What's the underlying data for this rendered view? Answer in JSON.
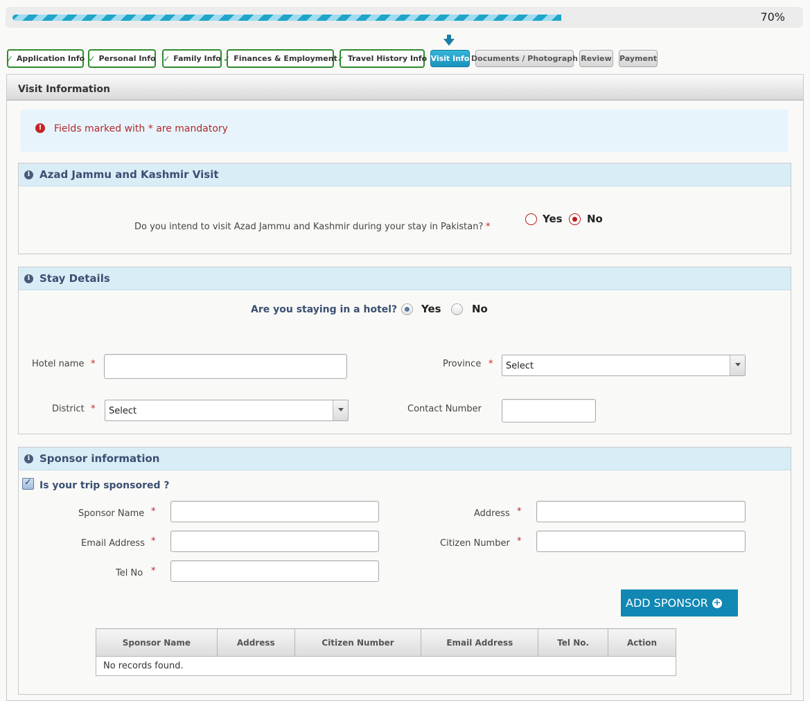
{
  "progress": {
    "percent_label": "70%",
    "fraction": 0.7
  },
  "steps": [
    {
      "label": "Application Info",
      "state": "done"
    },
    {
      "label": "Personal Info",
      "state": "done"
    },
    {
      "label": "Family Info",
      "state": "done"
    },
    {
      "label": "Finances & Employment",
      "state": "done"
    },
    {
      "label": "Travel History Info",
      "state": "done"
    },
    {
      "label": "Visit Info",
      "state": "active"
    },
    {
      "label": "Documents / Photograph",
      "state": "todo"
    },
    {
      "label": "Review",
      "state": "todo"
    },
    {
      "label": "Payment",
      "state": "todo"
    }
  ],
  "check_mark": "✓",
  "panel": {
    "title": "Visit Information"
  },
  "mandatory_note": {
    "text_before": "Fields marked with ",
    "asterisk": "*",
    "text_after": " are mandatory"
  },
  "asterisk": "*",
  "ajk": {
    "title": "Azad Jammu and Kashmir Visit",
    "question": "Do you intend to visit Azad Jammu and Kashmir during your stay in Pakistan?",
    "yes": "Yes",
    "no": "No",
    "selected": "No"
  },
  "stay": {
    "title": "Stay Details",
    "question": "Are you staying in a hotel?",
    "yes": "Yes",
    "no": "No",
    "selected": "Yes",
    "hotel_name_label": "Hotel name",
    "hotel_name_value": "",
    "province_label": "Province",
    "province_value": "Select",
    "district_label": "District",
    "district_value": "Select",
    "contact_label": "Contact Number",
    "contact_value": ""
  },
  "sponsor": {
    "title": "Sponsor information",
    "checkbox_label": "Is your trip sponsored ?",
    "checked": true,
    "name_label": "Sponsor Name",
    "address_label": "Address",
    "email_label": "Email Address",
    "citizen_label": "Citizen Number",
    "tel_label": "Tel No",
    "add_button": "ADD SPONSOR",
    "table_headers": [
      "Sponsor Name",
      "Address",
      "Citizen Number",
      "Email Address",
      "Tel No.",
      "Action"
    ],
    "empty_text": "No records found."
  },
  "colors": {
    "accent": "#1a93bd",
    "done_border": "#2e8b2e",
    "required": "#c52424",
    "section_header": "#d9edf7"
  }
}
